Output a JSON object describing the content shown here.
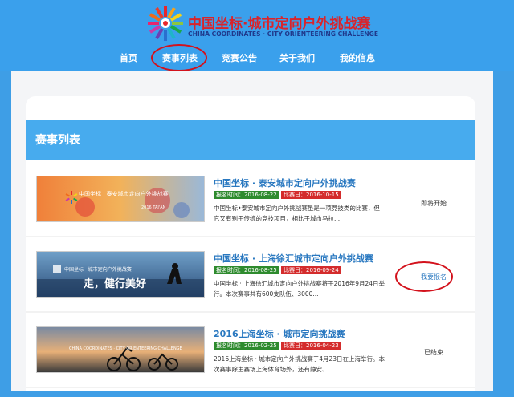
{
  "header": {
    "logo_cn": "中国坐标·城市定向户外挑战赛",
    "logo_en": "CHINA COORDINATES · CITY ORIENTEERING CHALLENGE"
  },
  "nav": {
    "items": [
      {
        "label": "首页"
      },
      {
        "label": "赛事列表"
      },
      {
        "label": "竞赛公告"
      },
      {
        "label": "关于我们"
      },
      {
        "label": "我的信息"
      }
    ],
    "active": "赛事列表"
  },
  "section": {
    "title": "赛事列表"
  },
  "events": [
    {
      "title": "中国坐标 · 泰安城市定向户外挑战赛",
      "signup_label": "报名时间：2016-08-22",
      "match_label": "比赛日：2016-10-15",
      "description": "中国坐标•泰安城市定向户外挑战赛虽是一项竞技类的比赛，但它又有别于传统的竞技项目，相比于城市马拉...",
      "status": "即将开始",
      "banner_text": "2016 TAI'AN",
      "banner_title": "中国坐标 · 泰安城市定向户外挑战赛"
    },
    {
      "title": "中国坐标 · 上海徐汇城市定向户外挑战赛",
      "signup_label": "报名时间：2016-08-25",
      "match_label": "比赛日：2016-09-24",
      "description": "中国坐标 · 上海徐汇城市定向户外挑战赛将于2016年9月24日举行。本次赛事共有600支队伍、3000...",
      "status": "我要报名",
      "banner_text": "走，健行美好",
      "banner_title": "中国坐标 · 城市定向户外挑战赛"
    },
    {
      "title": "2016上海坐标 · 城市定向挑战赛",
      "signup_label": "报名时间：2016-02-25",
      "match_label": "比赛日：2016-04-23",
      "description": "2016上海坐标 · 城市定向户外挑战赛于4月23日在上海举行。本次赛事除主赛场上海体育场外，还有静安、...",
      "status": "已结束",
      "banner_text": "",
      "banner_title": "CHINA COORDINATES · CITY ORIENTEERING CHALLENGE"
    }
  ],
  "colors": {
    "header_bg": "#3aa0ec",
    "title_bar": "#47abee",
    "link_blue": "#2978c0",
    "signup_tag": "#2e8b2e",
    "match_tag": "#d42c2c",
    "annotation_red": "#d3121c"
  }
}
